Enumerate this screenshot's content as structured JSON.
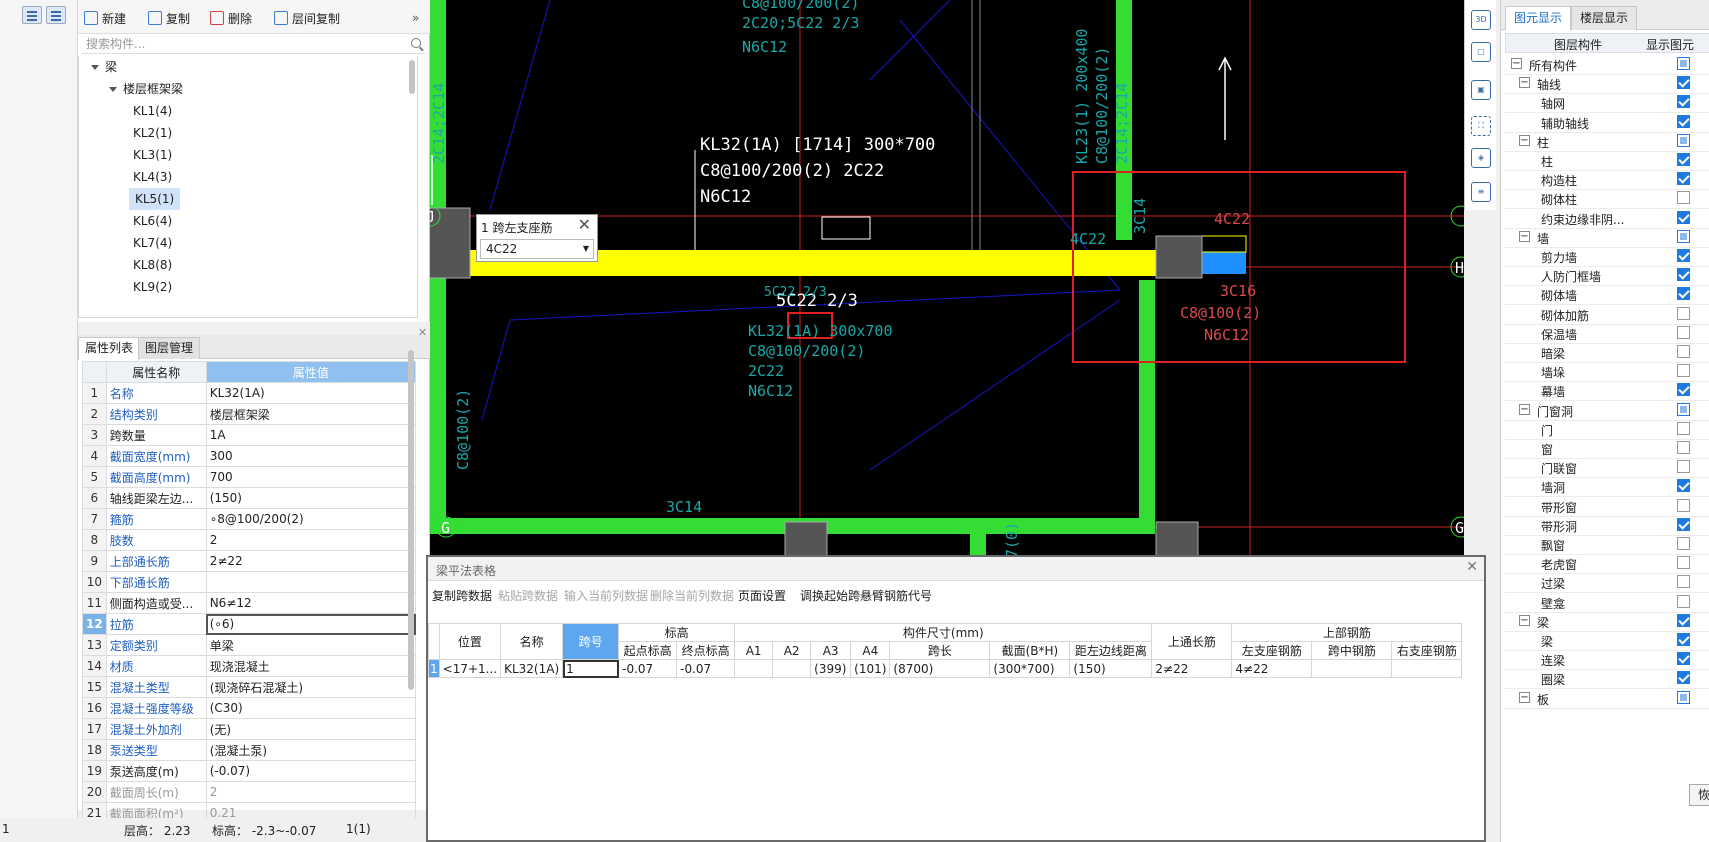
{
  "component_toolbar": {
    "new": "新建",
    "copy": "复制",
    "delete": "删除",
    "floor_copy": "层间复制"
  },
  "search": {
    "placeholder": "搜索构件..."
  },
  "tree": {
    "root": "梁",
    "group": "楼层框架梁",
    "items": [
      "KL1(4)",
      "KL2(1)",
      "KL3(1)",
      "KL4(3)",
      "KL5(1)",
      "KL6(4)",
      "KL7(4)",
      "KL8(8)",
      "KL9(2)"
    ],
    "selected": "KL5(1)"
  },
  "prop_tabs": [
    "属性列表",
    "图层管理"
  ],
  "prop_headers": {
    "name": "属性名称",
    "value": "属性值"
  },
  "properties": [
    {
      "n": "1",
      "name": "名称",
      "value": "KL32(1A)"
    },
    {
      "n": "2",
      "name": "结构类别",
      "value": "楼层框架梁"
    },
    {
      "n": "3",
      "name": "跨数量",
      "value": "1A"
    },
    {
      "n": "4",
      "name": "截面宽度(mm)",
      "value": "300"
    },
    {
      "n": "5",
      "name": "截面高度(mm)",
      "value": "700"
    },
    {
      "n": "6",
      "name": "轴线距梁左边...",
      "value": "(150)"
    },
    {
      "n": "7",
      "name": "箍筋",
      "value": "∘8@100/200(2)"
    },
    {
      "n": "8",
      "name": "肢数",
      "value": "2"
    },
    {
      "n": "9",
      "name": "上部通长筋",
      "value": "2≠22"
    },
    {
      "n": "10",
      "name": "下部通长筋",
      "value": ""
    },
    {
      "n": "11",
      "name": "侧面构造或受...",
      "value": "N6≠12"
    },
    {
      "n": "12",
      "name": "拉筋",
      "value": "(∘6)"
    },
    {
      "n": "13",
      "name": "定额类别",
      "value": "单梁"
    },
    {
      "n": "14",
      "name": "材质",
      "value": "现浇混凝土"
    },
    {
      "n": "15",
      "name": "混凝土类型",
      "value": "(现浇碎石混凝土)"
    },
    {
      "n": "16",
      "name": "混凝土强度等级",
      "value": "(C30)"
    },
    {
      "n": "17",
      "name": "混凝土外加剂",
      "value": "(无)"
    },
    {
      "n": "18",
      "name": "泵送类型",
      "value": "(混凝土泵)"
    },
    {
      "n": "19",
      "name": "泵送高度(m)",
      "value": "(-0.07)"
    },
    {
      "n": "20",
      "name": "截面周长(m)",
      "value": "2"
    },
    {
      "n": "21",
      "name": "截面面积(m²)",
      "value": "0.21"
    }
  ],
  "status_bar": {
    "left": "1",
    "floor_height": "层高： 2.23",
    "elevation": "标高： -2.3~-0.07",
    "count": "1(1)"
  },
  "cad": {
    "label_main_1": "KL32(1A) [1714] 300*700",
    "label_main_2": "C8@100/200(2) 2C22",
    "label_main_3": "N6C12",
    "label_bottom": "5C22 2/3",
    "top_text_1": "C8@100/200(2)",
    "top_text_2": "2C20;5C22 2/3",
    "top_text_3": "N6C12",
    "left_vertical": "2C14;2C14",
    "left_vertical_2": "C8@100(2)",
    "kl23_1": "KL23(1) 200x400",
    "kl23_2": "C8@100/200(2)",
    "kl23_3": "2C14;2C14",
    "mid_1": "KL32(1A) 300x700",
    "mid_2": "C8@100/200(2)",
    "mid_3": "2C22",
    "mid_4": "N6C12",
    "mid_5": "5C22 2/3",
    "c3c14_bottom": "3C14",
    "c3c14_right": "3C14",
    "c4c22_a": "4C22",
    "c4c22_b": "4C22",
    "red_1": "3C16",
    "red_2": "C8@100(2)",
    "red_3": "N6C12",
    "axis_j": "J",
    "axis_h": "H",
    "axis_g": "G",
    "bottom_label": "7(0)"
  },
  "span_popup": {
    "title": "1 跨左支座筋",
    "value": "4C22"
  },
  "right_tools": [
    "3D",
    "cube",
    "box",
    "fit",
    "3d-view",
    "list"
  ],
  "layer_panel": {
    "tabs": [
      "图元显示",
      "楼层显示"
    ],
    "headers": {
      "layer": "图层构件",
      "show": "显示图元"
    },
    "rows": [
      {
        "label": "所有构件",
        "level": 0,
        "expander": "−",
        "state": "part"
      },
      {
        "label": "轴线",
        "level": 1,
        "expander": "−",
        "state": "on"
      },
      {
        "label": "轴网",
        "level": 2,
        "state": "on"
      },
      {
        "label": "辅助轴线",
        "level": 2,
        "state": "on"
      },
      {
        "label": "柱",
        "level": 1,
        "expander": "−",
        "state": "part"
      },
      {
        "label": "柱",
        "level": 2,
        "state": "on"
      },
      {
        "label": "构造柱",
        "level": 2,
        "state": "on"
      },
      {
        "label": "砌体柱",
        "level": 2,
        "state": "off"
      },
      {
        "label": "约束边缘非阴...",
        "level": 2,
        "state": "on"
      },
      {
        "label": "墙",
        "level": 1,
        "expander": "−",
        "state": "part"
      },
      {
        "label": "剪力墙",
        "level": 2,
        "state": "on"
      },
      {
        "label": "人防门框墙",
        "level": 2,
        "state": "on"
      },
      {
        "label": "砌体墙",
        "level": 2,
        "state": "on"
      },
      {
        "label": "砌体加筋",
        "level": 2,
        "state": "off"
      },
      {
        "label": "保温墙",
        "level": 2,
        "state": "off"
      },
      {
        "label": "暗梁",
        "level": 2,
        "state": "off"
      },
      {
        "label": "墙垛",
        "level": 2,
        "state": "off"
      },
      {
        "label": "幕墙",
        "level": 2,
        "state": "on"
      },
      {
        "label": "门窗洞",
        "level": 1,
        "expander": "−",
        "state": "part"
      },
      {
        "label": "门",
        "level": 2,
        "state": "off"
      },
      {
        "label": "窗",
        "level": 2,
        "state": "off"
      },
      {
        "label": "门联窗",
        "level": 2,
        "state": "off"
      },
      {
        "label": "墙洞",
        "level": 2,
        "state": "on"
      },
      {
        "label": "带形窗",
        "level": 2,
        "state": "off"
      },
      {
        "label": "带形洞",
        "level": 2,
        "state": "on"
      },
      {
        "label": "飘窗",
        "level": 2,
        "state": "off"
      },
      {
        "label": "老虎窗",
        "level": 2,
        "state": "off"
      },
      {
        "label": "过梁",
        "level": 2,
        "state": "off"
      },
      {
        "label": "壁龛",
        "level": 2,
        "state": "off"
      },
      {
        "label": "梁",
        "level": 1,
        "expander": "−",
        "state": "on"
      },
      {
        "label": "梁",
        "level": 2,
        "state": "on"
      },
      {
        "label": "连梁",
        "level": 2,
        "state": "on"
      },
      {
        "label": "圈梁",
        "level": 2,
        "state": "on"
      },
      {
        "label": "板",
        "level": 1,
        "expander": "−",
        "state": "part"
      }
    ],
    "restore_button": "恢"
  },
  "beam_table": {
    "title": "梁平法表格",
    "menu": [
      {
        "label": "复制跨数据",
        "enabled": true
      },
      {
        "label": "粘贴跨数据",
        "enabled": false
      },
      {
        "label": "输入当前列数据",
        "enabled": false
      },
      {
        "label": "删除当前列数据",
        "enabled": false
      },
      {
        "label": "页面设置",
        "enabled": true
      },
      {
        "label": "调换起始跨",
        "enabled": true
      },
      {
        "label": "悬臂钢筋代号",
        "enabled": true
      }
    ],
    "group_headers": {
      "elevation": "标高",
      "dimensions": "构件尺寸(mm)",
      "top_rebar": "上部钢筋"
    },
    "columns": [
      "位置",
      "名称",
      "跨号",
      "起点标高",
      "终点标高",
      "A1",
      "A2",
      "A3",
      "A4",
      "跨长",
      "截面(B*H)",
      "距左边线距离",
      "上通长筋",
      "左支座钢筋",
      "跨中钢筋",
      "右支座钢筋"
    ],
    "row": {
      "num": "1",
      "cells": [
        "<17+1...",
        "KL32(1A)",
        "1",
        "-0.07",
        "-0.07",
        "",
        "",
        "(399)",
        "(101)",
        "(8700)",
        "(300*700)",
        "(150)",
        "2≠22",
        "4≠22",
        "",
        ""
      ]
    }
  },
  "colors": {
    "beam_yellow": "#ffff00",
    "column_green": "#33dd33",
    "axis_red": "#cc2222",
    "selection_blue": "#1f7ae0"
  }
}
